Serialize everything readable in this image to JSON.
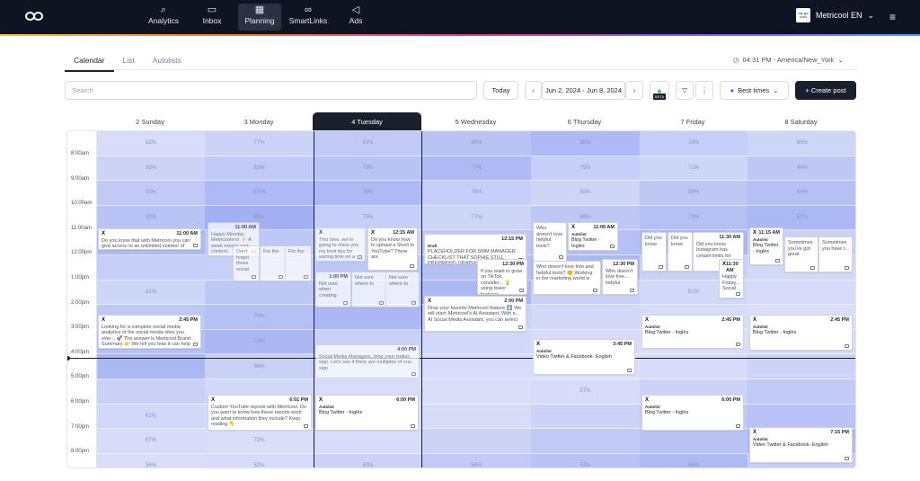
{
  "nav": {
    "items": [
      {
        "label": "Analytics",
        "icon": "analytics-icon",
        "glyph": "⌕"
      },
      {
        "label": "Inbox",
        "icon": "inbox-icon",
        "glyph": "▭"
      },
      {
        "label": "Planning",
        "icon": "calendar-icon",
        "glyph": "▦"
      },
      {
        "label": "SmartLinks",
        "icon": "link-icon",
        "glyph": "∞"
      },
      {
        "label": "Ads",
        "icon": "megaphone-icon",
        "glyph": "◁"
      }
    ],
    "account_name": "Metricool EN",
    "avatar_text": "my go cool"
  },
  "tabs": [
    "Calendar",
    "List",
    "Autolists"
  ],
  "timezone": "04:31 PM - America/New_York",
  "toolbar": {
    "search_placeholder": "Search",
    "today_label": "Today",
    "date_range": "Jun 2, 2024 - Jun 8, 2024",
    "beta_label": "BETA",
    "best_times_label": "Best times",
    "create_post_label": "+ Create post"
  },
  "days": [
    "2 Sunday",
    "3 Monday",
    "4 Tuesday",
    "5 Wednesday",
    "6 Thursday",
    "7 Friday",
    "8 Saturday"
  ],
  "times": [
    "8:00am",
    "9:00am",
    "10:00am",
    "11:00am",
    "12:00pm",
    "1:00pm",
    "2:00pm",
    "3:00pm",
    "4:00pm",
    "5:00pm",
    "6:00pm",
    "7:00pm",
    "8:00pm"
  ],
  "percentages": [
    [
      "52%",
      "50%",
      "50%",
      "50%",
      "",
      "",
      "61%",
      "",
      "",
      "",
      "",
      "61%",
      "67%",
      "56%"
    ],
    [
      "77%",
      "83%",
      "100%",
      "80%",
      "",
      "",
      "",
      "79%",
      "72%",
      "86%",
      "",
      "",
      "72%",
      "52%"
    ],
    [
      "67%",
      "79%",
      "76%",
      "75%",
      "",
      "",
      "",
      "",
      "",
      "100%",
      "",
      "",
      "",
      "50%"
    ],
    [
      "80%",
      "77%",
      "76%",
      "77%",
      "",
      "",
      "",
      "",
      "",
      "",
      "",
      "",
      "",
      "59%"
    ],
    [
      "80%",
      "75%",
      "82%",
      "89%",
      "",
      "",
      "",
      "",
      "",
      "",
      "57%",
      "",
      "",
      "53%"
    ],
    [
      "78%",
      "71%",
      "88%",
      "73%",
      "",
      "",
      "81%",
      "",
      "",
      "",
      "",
      "",
      "",
      "56%"
    ],
    [
      "65%",
      "49%",
      "64%",
      "57%",
      "",
      "",
      "",
      "",
      "",
      "",
      "",
      "",
      "",
      ""
    ]
  ],
  "cards": [
    {
      "net": "X",
      "time": "11:00 AM",
      "text": "Do you know that with Metricool you can give access to an unlimited number of members of your team so that they can also participate in the management of digital"
    },
    {
      "net": "X",
      "time": "2:45 PM",
      "text": "Looking for a complete social media analytics of the social media sites you ever... 🚀 The answer is Metricool Brand Summary 👉 We tell you how it can help"
    },
    {
      "net": "",
      "time": "11:00 AM",
      "text": "Happy Monday Metricoolers! ⚡ A week means new content."
    },
    {
      "net": "",
      "time": "",
      "text": "Don't forget these social"
    },
    {
      "net": "",
      "time": "",
      "text": "For the"
    },
    {
      "net": "",
      "time": "",
      "text": "For the"
    },
    {
      "net": "X",
      "time": "6:01 PM",
      "text": "Custom YouTube reports with Metricool. Do you want to know how these reports work and what information they include? Keep reading 👇"
    },
    {
      "net": "X",
      "time": "",
      "text": "This time, we're going to show you my best tips for saving time on a mega-mailing campaign... Do you want to know how to do it?"
    },
    {
      "net": "X",
      "time": "12:15 AM",
      "text": "Do you know how to upload a Short to YouTube? There are"
    },
    {
      "net": "",
      "time": "1:00 PM",
      "text": "Not sure when creating"
    },
    {
      "net": "",
      "time": "",
      "text": "Not sure where to"
    },
    {
      "net": "",
      "time": "",
      "text": "Not sure where to"
    },
    {
      "net": "",
      "time": "4:00 PM",
      "text": "Social Media Managers, drop your zodiac sign. Let's see if there are multiples of one. sign"
    },
    {
      "net": "X",
      "time": "6:00 PM",
      "auto": "Autolist",
      "title": "Blog Twitter - Inglés"
    },
    {
      "net": "",
      "time": "12:15 PM",
      "draft": "Draft",
      "text": "PLACEHOLDER FOR SMM MANAGER CHECKLIST THAT SOPHIE STILL PREPARING GRAPHIC FROM MAI"
    },
    {
      "net": "",
      "time": "12:30 PM",
      "text": "If you want to grow on TikTok, consider... 💡 using fewer features"
    },
    {
      "net": "X",
      "time": "2:00 PM",
      "text": "Drop your favorite Metricool feature ⬇️ We will start: Metricool's AI Assistant. With e... AI Social Media Assistant, you can select"
    },
    {
      "net": "",
      "time": "",
      "text": "Who doesn't love helpful tools?"
    },
    {
      "net": "X",
      "time": "11:00 AM",
      "auto": "Autolist",
      "title": "Blog Twitter - Inglés"
    },
    {
      "net": "",
      "time": "",
      "text": "Who doesn't love free and helpful tools? 😊 Working in the marketing world is"
    },
    {
      "net": "",
      "time": "12:30 PM",
      "text": "Who doesn't love free... helpful"
    },
    {
      "net": "X",
      "time": "3:45 PM",
      "auto": "Autolist",
      "title": "Video Twitter & Facebook- English"
    },
    {
      "net": "",
      "time": "",
      "text": "Did you know"
    },
    {
      "net": "",
      "time": "",
      "text": "Did you know"
    },
    {
      "net": "",
      "time": "11:30 AM",
      "text": "Did you know Instagram has certain limits for"
    },
    {
      "net": "X",
      "time": "11:30 AM",
      "text": "Happy Friday... Social"
    },
    {
      "net": "X",
      "time": "2:45 PM",
      "auto": "Autolist",
      "title": "Blog Twitter - Inglés"
    },
    {
      "net": "X",
      "time": "6:00 PM",
      "auto": "Autolist",
      "title": "Blog Twitter - Inglés"
    },
    {
      "net": "X",
      "time": "11:15 AM",
      "auto": "Autolist",
      "title": "Blog Twitter - Inglés"
    },
    {
      "net": "",
      "time": "",
      "text": "Sometimes you've got great"
    },
    {
      "net": "",
      "time": "",
      "text": "Sometimes you have t..."
    },
    {
      "net": "X",
      "time": "2:45 PM",
      "auto": "Autolist",
      "title": "Blog Twitter - Inglés"
    },
    {
      "net": "X",
      "time": "7:15 PM",
      "auto": "Autolist",
      "title": "Video Twitter & Facebook- English"
    }
  ]
}
